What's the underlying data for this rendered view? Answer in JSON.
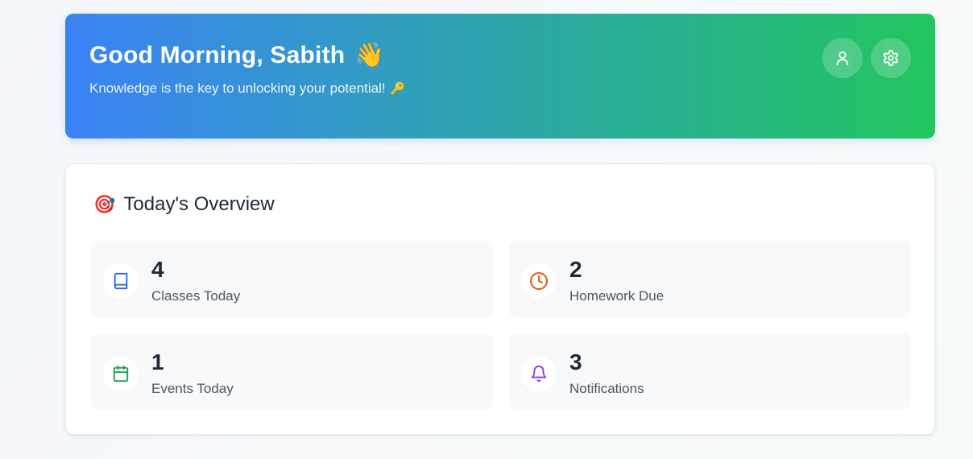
{
  "hero": {
    "greeting": "Good Morning, Sabith",
    "greeting_emoji": "👋",
    "subtitle": "Knowledge is the key to unlocking your potential!",
    "subtitle_emoji": "🔑",
    "actions": [
      {
        "name": "profile",
        "icon": "user-icon"
      },
      {
        "name": "settings",
        "icon": "gear-icon"
      }
    ]
  },
  "overview": {
    "title": "Today's Overview",
    "title_emoji": "🎯",
    "stats": [
      {
        "value": "4",
        "label": "Classes Today",
        "icon": "book-icon",
        "color": "#2563eb"
      },
      {
        "value": "2",
        "label": "Homework Due",
        "icon": "clock-icon",
        "color": "#ea580c"
      },
      {
        "value": "1",
        "label": "Events Today",
        "icon": "calendar-icon",
        "color": "#16a34a"
      },
      {
        "value": "3",
        "label": "Notifications",
        "icon": "bell-icon",
        "color": "#9333ea"
      }
    ]
  }
}
